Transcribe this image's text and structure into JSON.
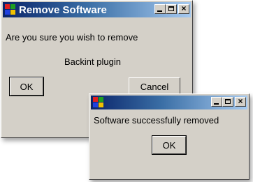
{
  "remove_dialog": {
    "title": "Remove Software",
    "message": "Are you sure you wish to remove",
    "item_name": "Backint plugin",
    "ok_label": "OK",
    "cancel_label": "Cancel",
    "caption_close_glyph": "×"
  },
  "success_dialog": {
    "title": "",
    "message": "Software successfully removed",
    "ok_label": "OK",
    "caption_close_glyph": "×"
  },
  "colors": {
    "window_face": "#d4d0c8",
    "titlebar_start": "#0a246a",
    "titlebar_end": "#a6caf0"
  },
  "icons": {
    "app_icon": "windows-logo-icon",
    "minimize": "minimize-icon",
    "maximize": "maximize-icon",
    "close": "close-icon"
  }
}
